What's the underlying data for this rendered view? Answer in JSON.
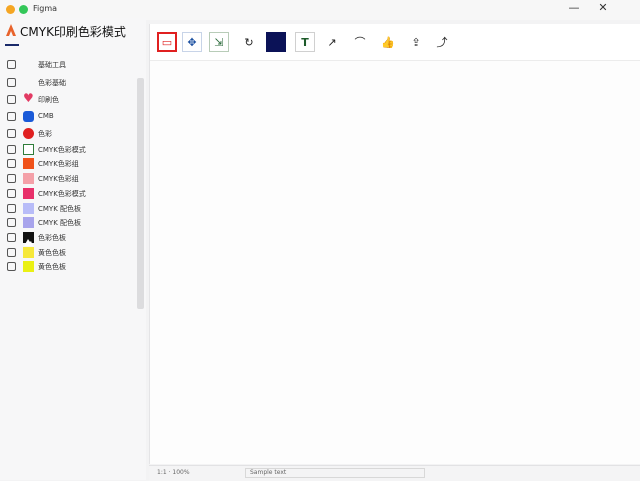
{
  "window": {
    "title": "Figma",
    "minimize_label": "—",
    "close_label": "✕"
  },
  "app": {
    "title": "CMYK印刷色彩模式",
    "logo_icon": "brand-logo-icon",
    "brand_color": "#e8632c"
  },
  "sidebar": {
    "items": [
      {
        "icon": "doc-icon",
        "swatch": null,
        "label": "基础工具"
      },
      {
        "icon": "image-icon",
        "swatch": null,
        "label": "色彩基础"
      },
      {
        "icon": "print-icon",
        "swatch": "heart",
        "color": "#e23a63",
        "label": "印刷色"
      },
      {
        "icon": "lock-icon",
        "swatch": "rounded",
        "color": "#1a5ad8",
        "label": "CMB"
      },
      {
        "icon": "box-icon",
        "swatch": "circle",
        "color": "#e02020",
        "label": "色彩"
      },
      {
        "icon": "folder-icon",
        "swatch": "outline",
        "color": "#2f7d3a",
        "label": "CMYK色彩模式"
      },
      {
        "icon": "folder-icon",
        "swatch": "square",
        "color": "#f0521a",
        "label": "CMYK色彩组"
      },
      {
        "icon": "folder-icon",
        "swatch": "square",
        "color": "#f4a0a8",
        "label": "CMYK色彩组"
      },
      {
        "icon": "clock-icon",
        "swatch": "square",
        "color": "#e8306a",
        "label": "CMYK色彩模式"
      },
      {
        "icon": "clock-icon",
        "swatch": "square",
        "color": "#b8bcf8",
        "label": "CMYK 配色板"
      },
      {
        "icon": "clock-icon",
        "swatch": "square",
        "color": "#a8a4ec",
        "label": "CMYK 配色板"
      },
      {
        "icon": "eye-icon",
        "swatch": "mountain",
        "color": "#111111",
        "label": "色彩色板"
      },
      {
        "icon": "clock-icon",
        "swatch": "square",
        "color": "#f6e83a",
        "label": "黄色色板"
      },
      {
        "icon": "alert-icon",
        "swatch": "square",
        "color": "#eaf014",
        "label": "黄色色板"
      }
    ]
  },
  "toolbar": {
    "tools": [
      {
        "name": "frame-tool-icon",
        "glyph": "▭",
        "style": "red"
      },
      {
        "name": "fill-tool-icon",
        "glyph": "✥",
        "style": "blue"
      },
      {
        "name": "scale-tool-icon",
        "glyph": "⇲",
        "style": "green"
      },
      {
        "name": "rotate-tool-icon",
        "glyph": "↻",
        "style": "plain"
      },
      {
        "name": "color-swatch-navy",
        "glyph": "",
        "style": "navy"
      },
      {
        "name": "text-tool-icon",
        "glyph": "T",
        "style": "darkgreen"
      },
      {
        "name": "chart-tool-icon",
        "glyph": "↗",
        "style": "plain"
      },
      {
        "name": "curve-tool-icon",
        "glyph": "⌒",
        "style": "plain"
      },
      {
        "name": "thumbs-up-icon",
        "glyph": "👍",
        "style": "plain"
      },
      {
        "name": "upload-icon",
        "glyph": "⇪",
        "style": "plain"
      },
      {
        "name": "share-icon",
        "glyph": "⤴",
        "style": "plain"
      }
    ]
  },
  "status": {
    "left_text": "1:1 · 100%",
    "field_text": "Sample text"
  }
}
